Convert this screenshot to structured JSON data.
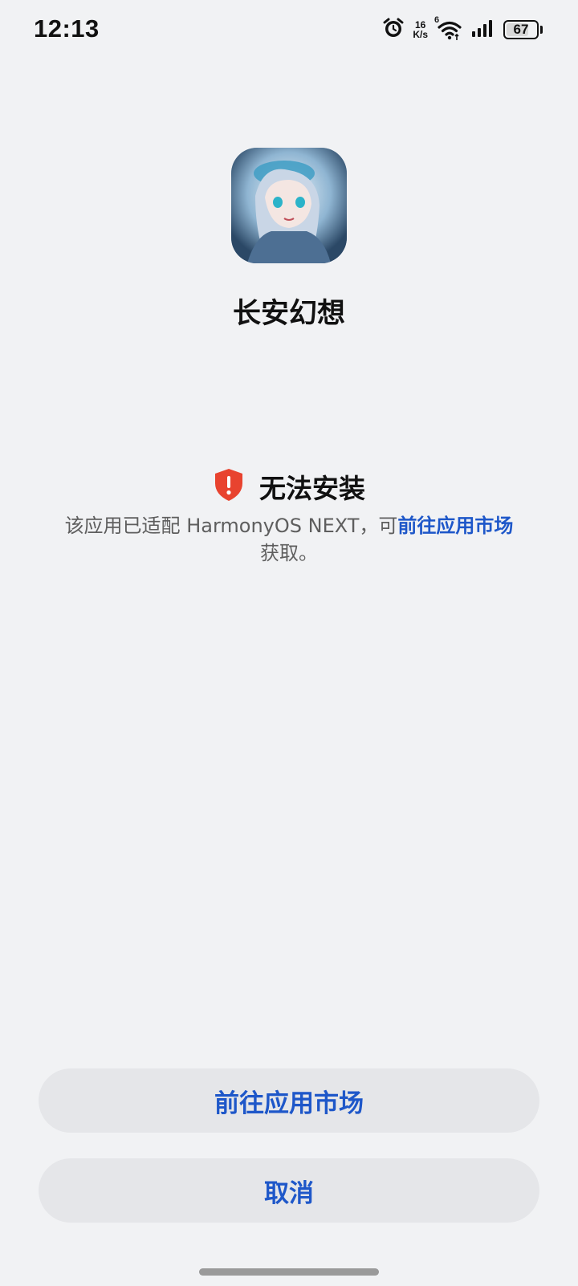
{
  "status_bar": {
    "time": "12:13",
    "net_speed_value": "16",
    "net_speed_unit": "K/s",
    "wifi_label": "6",
    "battery": "67",
    "icons": [
      "alarm-icon",
      "wifi-icon",
      "signal-icon",
      "battery-icon"
    ]
  },
  "app": {
    "name": "长安幻想"
  },
  "dialog": {
    "error_title": "无法安装",
    "description_prefix": "该应用已适配 HarmonyOS NEXT，可",
    "description_link": "前往应用市场",
    "description_suffix": "获取。"
  },
  "buttons": {
    "go_to_market": "前往应用市场",
    "cancel": "取消"
  },
  "colors": {
    "accent": "#1e57c9",
    "error": "#e8432f",
    "background": "#f1f2f4"
  }
}
